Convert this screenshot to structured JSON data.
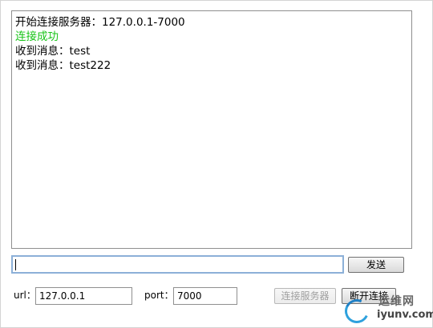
{
  "log": {
    "lines": [
      {
        "text": "开始连接服务器：127.0.0.1-7000",
        "color": "#000000"
      },
      {
        "text": "连接成功",
        "color": "#18c418"
      },
      {
        "text": "收到消息：test",
        "color": "#000000"
      },
      {
        "text": "收到消息：test222",
        "color": "#000000"
      }
    ]
  },
  "message": {
    "value": "",
    "send_label": "发送"
  },
  "connection": {
    "url_label": "url：",
    "url_value": "127.0.0.1",
    "port_label": "port：",
    "port_value": "7000",
    "connect_label": "连接服务器",
    "disconnect_label": "断开连接"
  },
  "watermark": {
    "top_text": "运维网",
    "bottom_text": "iyunv.com"
  },
  "colors": {
    "success": "#18c418",
    "input_focus_border": "#8cb0d8",
    "watermark_blue": "#2ea1dd"
  }
}
